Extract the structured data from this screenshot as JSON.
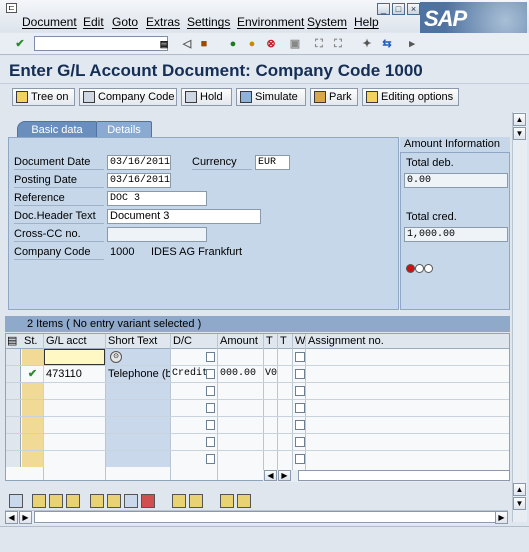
{
  "menu": {
    "items": [
      "Document",
      "Edit",
      "Goto",
      "Extras",
      "Settings",
      "Environment",
      "System",
      "Help"
    ]
  },
  "window_controls": [
    "_",
    "□",
    "×"
  ],
  "logo": {
    "text": "SAP"
  },
  "title": "Enter G/L Account Document: Company Code 1000",
  "app_toolbar": {
    "tree_on": "Tree on",
    "company_code": "Company Code",
    "hold": "Hold",
    "simulate": "Simulate",
    "park": "Park",
    "editing_options": "Editing options"
  },
  "tabs": {
    "basic_data": "Basic data",
    "details": "Details"
  },
  "form": {
    "document_date_label": "Document Date",
    "document_date": "03/16/2011",
    "currency_label": "Currency",
    "currency": "EUR",
    "posting_date_label": "Posting Date",
    "posting_date": "03/16/2011",
    "reference_label": "Reference",
    "reference": "DOC 3",
    "doc_header_text_label": "Doc.Header Text",
    "doc_header_text": "Document 3",
    "cross_cc_label": "Cross-CC no.",
    "cross_cc": "",
    "company_code_label": "Company Code",
    "company_code": "1000",
    "company_name": "IDES AG Frankfurt"
  },
  "amount_info": {
    "header": "Amount Information",
    "total_deb_label": "Total deb.",
    "total_deb": "0.00",
    "total_cred_label": "Total cred.",
    "total_cred": "1,000.00",
    "status_light": "red"
  },
  "items_table": {
    "title": "2 Items ( No entry variant selected )",
    "columns": [
      "St.",
      "G/L acct",
      "Short Text",
      "D/C",
      "Amount",
      "T",
      "T",
      "W",
      "Assignment no."
    ],
    "rows": [
      {
        "status": "",
        "gl_acct": "",
        "short_text": "",
        "dc": "",
        "amount": "",
        "t1": "",
        "t2": ""
      },
      {
        "status": "check",
        "gl_acct": "473110",
        "short_text": "Telephone (b",
        "dc": "Credit",
        "amount": "000.00",
        "t1": "V0",
        "t2": ""
      }
    ]
  },
  "colors": {
    "accent": "#152e55",
    "panel": "#c6d7ea",
    "tab_active": "#6a8fbd"
  }
}
